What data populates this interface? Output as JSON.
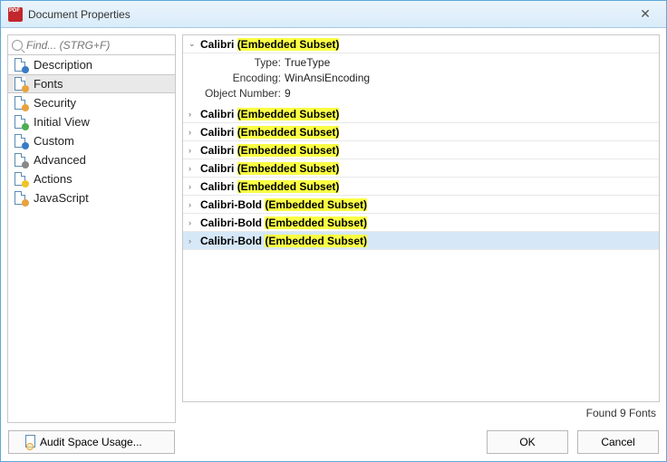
{
  "window": {
    "title": "Document Properties"
  },
  "search": {
    "placeholder": "Find... (STRG+F)"
  },
  "sidebar": {
    "items": [
      {
        "label": "Description"
      },
      {
        "label": "Fonts"
      },
      {
        "label": "Security"
      },
      {
        "label": "Initial View"
      },
      {
        "label": "Custom"
      },
      {
        "label": "Advanced"
      },
      {
        "label": "Actions"
      },
      {
        "label": "JavaScript"
      }
    ],
    "selected": 1
  },
  "fonts": {
    "items": [
      {
        "name": "Calibri",
        "suffix": "(Embedded Subset)",
        "expanded": true,
        "details": {
          "type": "TrueType",
          "encoding": "WinAnsiEncoding",
          "object_number": "9"
        }
      },
      {
        "name": "Calibri",
        "suffix": "(Embedded Subset)"
      },
      {
        "name": "Calibri",
        "suffix": "(Embedded Subset)"
      },
      {
        "name": "Calibri",
        "suffix": "(Embedded Subset)"
      },
      {
        "name": "Calibri",
        "suffix": "(Embedded Subset)"
      },
      {
        "name": "Calibri",
        "suffix": "(Embedded Subset)"
      },
      {
        "name": "Calibri-Bold",
        "suffix": "(Embedded Subset)"
      },
      {
        "name": "Calibri-Bold",
        "suffix": "(Embedded Subset)"
      },
      {
        "name": "Calibri-Bold",
        "suffix": "(Embedded Subset)",
        "selected": true
      }
    ],
    "detail_labels": {
      "type": "Type:",
      "encoding": "Encoding:",
      "object_number": "Object Number:"
    },
    "found_text": "Found 9 Fonts"
  },
  "buttons": {
    "audit": "Audit Space Usage...",
    "ok": "OK",
    "cancel": "Cancel"
  }
}
